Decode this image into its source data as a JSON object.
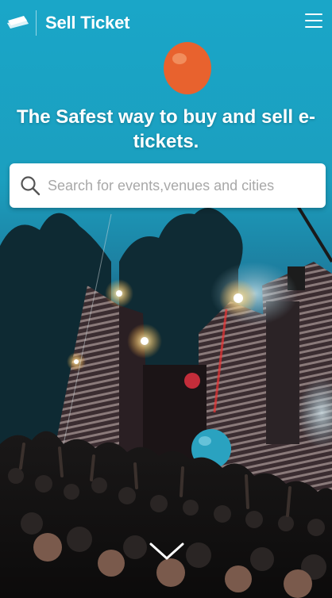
{
  "header": {
    "logo_icon": "ticket-icon",
    "brand": "Sell Ticket",
    "menu_icon": "hamburger-menu-icon"
  },
  "hero": {
    "headline": "The Safest way to buy and sell e-tickets.",
    "background": "concert-crowd-photo"
  },
  "search": {
    "icon": "search-icon",
    "placeholder": "Search for events,venues and cities",
    "value": ""
  },
  "scroll": {
    "icon": "chevron-down-icon"
  },
  "colors": {
    "sky": "#1aa6c8",
    "text": "#ffffff",
    "placeholder": "#a8a8a8"
  }
}
